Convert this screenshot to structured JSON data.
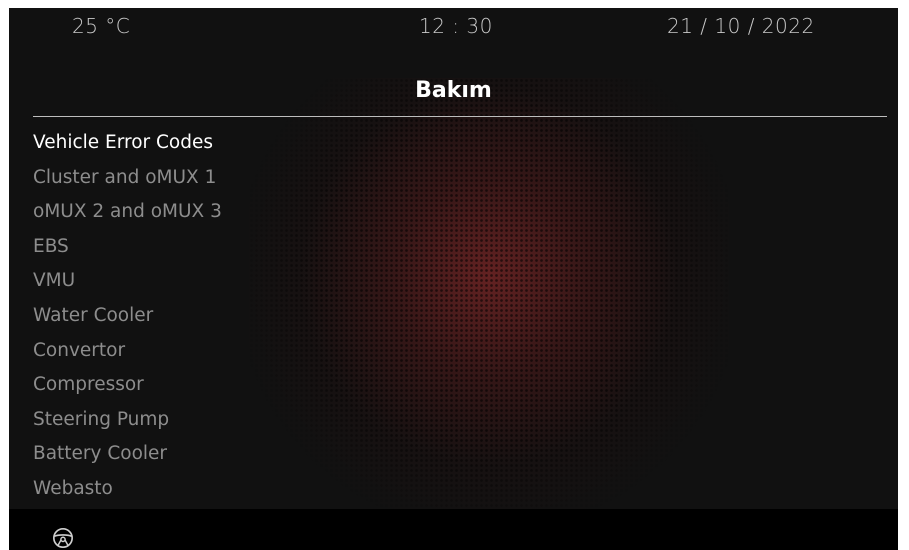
{
  "status_bar": {
    "temperature": "25 °C",
    "time": "12 : 30",
    "date": "21 / 10 / 2022"
  },
  "page": {
    "title": "Bakım"
  },
  "menu": {
    "items": [
      {
        "label": "Vehicle Error Codes",
        "selected": true
      },
      {
        "label": "Cluster and oMUX 1",
        "selected": false
      },
      {
        "label": "oMUX 2 and oMUX 3",
        "selected": false
      },
      {
        "label": "EBS",
        "selected": false
      },
      {
        "label": "VMU",
        "selected": false
      },
      {
        "label": "Water Cooler",
        "selected": false
      },
      {
        "label": "Convertor",
        "selected": false
      },
      {
        "label": "Compressor",
        "selected": false
      },
      {
        "label": "Steering Pump",
        "selected": false
      },
      {
        "label": "Battery Cooler",
        "selected": false
      },
      {
        "label": "Webasto",
        "selected": false
      }
    ]
  },
  "bottom_bar": {
    "icon": "steering-wheel-icon"
  },
  "colors": {
    "background": "#111111",
    "selected_text": "#ffffff",
    "unselected_text": "#8d8d8d",
    "accent_glow": "#7a2626"
  }
}
